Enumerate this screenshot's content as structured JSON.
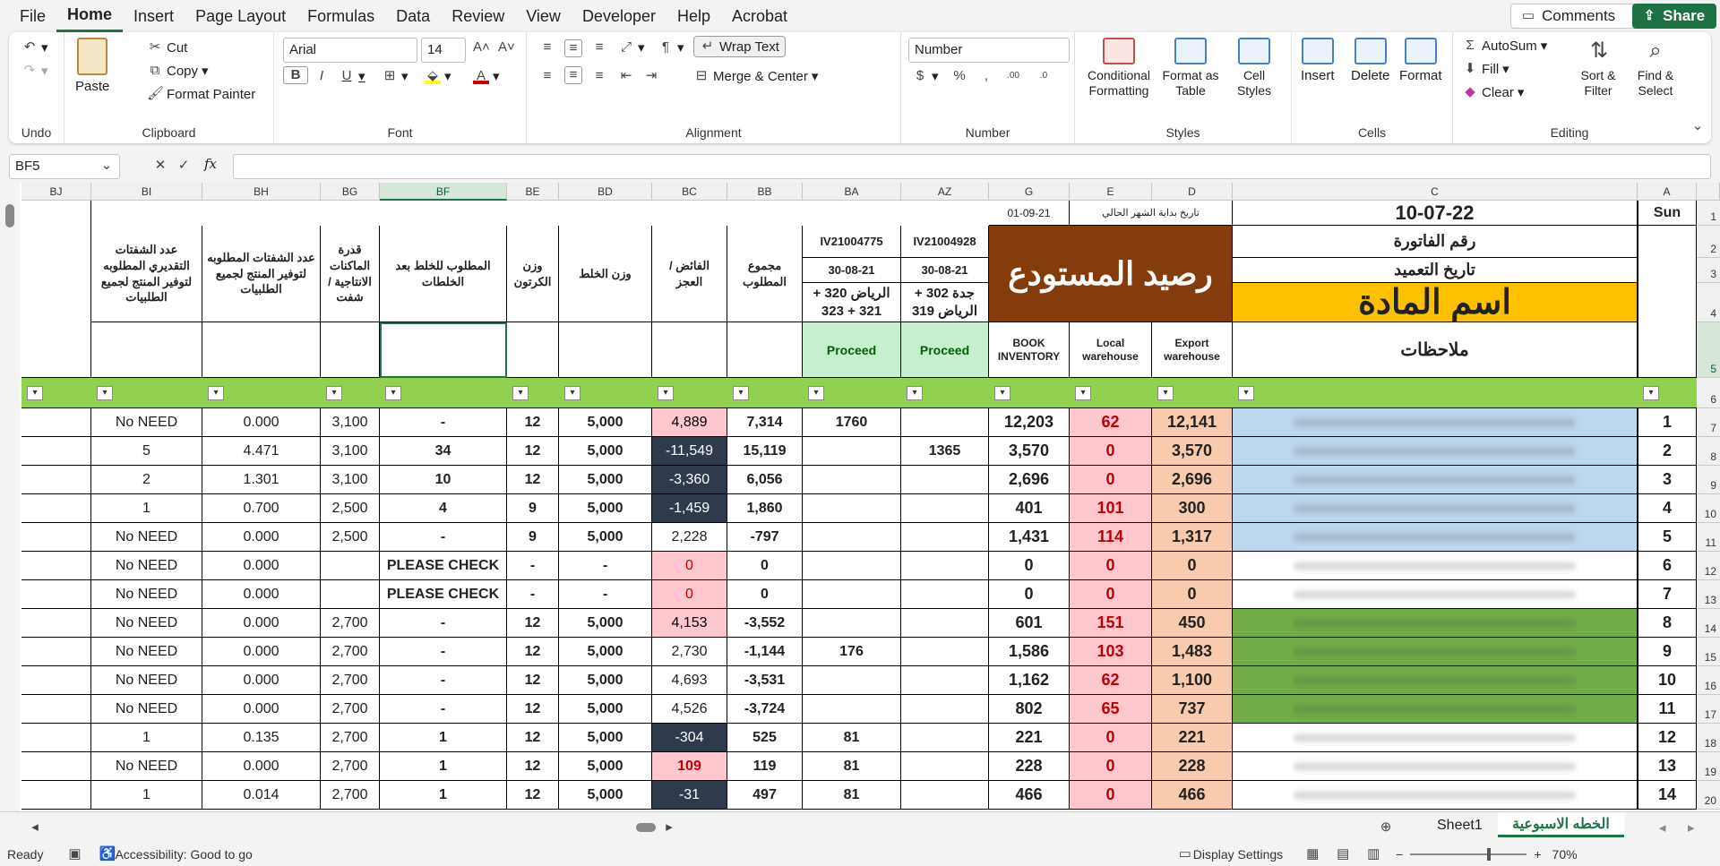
{
  "menu": {
    "items": [
      "File",
      "Home",
      "Insert",
      "Page Layout",
      "Formulas",
      "Data",
      "Review",
      "View",
      "Developer",
      "Help",
      "Acrobat"
    ],
    "active": "Home"
  },
  "top_buttons": {
    "comments": "Comments",
    "share": "Share"
  },
  "ribbon": {
    "undo_group": "Undo",
    "clipboard": {
      "paste": "Paste",
      "cut": "Cut",
      "copy": "Copy",
      "format_painter": "Format Painter",
      "label": "Clipboard"
    },
    "font": {
      "name": "Arial",
      "size": "14",
      "label": "Font"
    },
    "alignment": {
      "wrap_text": "Wrap Text",
      "merge_center": "Merge & Center",
      "label": "Alignment"
    },
    "number": {
      "format": "Number",
      "label": "Number"
    },
    "styles": {
      "conditional": "Conditional Formatting",
      "format_table": "Format as Table",
      "cell_styles": "Cell Styles",
      "label": "Styles"
    },
    "cells": {
      "insert": "Insert",
      "delete": "Delete",
      "format": "Format",
      "label": "Cells"
    },
    "editing": {
      "autosum": "AutoSum",
      "fill": "Fill",
      "clear": "Clear",
      "sort_filter": "Sort & Filter",
      "find_select": "Find & Select",
      "label": "Editing"
    }
  },
  "formula_bar": {
    "name_box": "BF5",
    "fx": "fx",
    "formula": ""
  },
  "columns": [
    "BJ",
    "BI",
    "BH",
    "BG",
    "BF",
    "BE",
    "BD",
    "BC",
    "BB",
    "BA",
    "AZ",
    "G",
    "E",
    "D",
    "C",
    "A"
  ],
  "header": {
    "date_right": "10-07-22",
    "day": "Sun",
    "start_date": "01-09-21",
    "start_label": "تاريخ بداية الشهر الحالي",
    "invoice_no": "رقم الفاتورة",
    "commission_date": "تاريخ التعميد",
    "material_name": "اسم المادة",
    "notes": "ملاحظات",
    "warehouse_balance": "رصيد المستودع",
    "book_inventory": "BOOK INVENTORY",
    "local_warehouse": "Local warehouse",
    "export_warehouse": "Export warehouse",
    "ba_invoice": "IV21004775",
    "ba_date": "30-08-21",
    "ba_dest": "الرياض 320 + 321 + 323",
    "ba_status": "Proceed",
    "az_invoice": "IV21004928",
    "az_date": "30-08-21",
    "az_dest": "جدة 302 + الرياض 319",
    "az_status": "Proceed",
    "bb": "مجموع المطلوب",
    "bc": "الفائض / العجز",
    "bd": "وزن الخلط",
    "be": "وزن الكرتون",
    "bf": "المطلوب للخلط بعد الخلطات",
    "bg": "قدرة الماكنات الانتاجية / شفت",
    "bh": "عدد الشفتات المطلوبه لتوفير المنتج لجميع الطلبيات",
    "bi": "عدد الشفتات التقديري المطلوبه لتوفير المنتج لجميع الطلبيات"
  },
  "row_numbers": [
    "1",
    "2",
    "3",
    "4",
    "5",
    "6",
    "7",
    "8",
    "9",
    "10",
    "11",
    "12",
    "13",
    "14",
    "15",
    "16",
    "17",
    "18",
    "19",
    "20"
  ],
  "rows": [
    {
      "bi": "No NEED",
      "bh": "0.000",
      "bg": "3,100",
      "bf": "-",
      "be": "12",
      "bd": "5,000",
      "bc": "4,889",
      "bb": "7,314",
      "ba": "1760",
      "az": "",
      "g": "12,203",
      "e": "62",
      "d": "12,141",
      "a": "1",
      "bc_style": "pink",
      "c_style": "blue",
      "row": "7"
    },
    {
      "bi": "5",
      "bh": "4.471",
      "bg": "3,100",
      "bf": "34",
      "be": "12",
      "bd": "5,000",
      "bc": "-11,549",
      "bb": "15,119",
      "ba": "",
      "az": "1365",
      "g": "3,570",
      "e": "0",
      "d": "3,570",
      "a": "2",
      "bc_style": "dark",
      "c_style": "blue",
      "row": "8"
    },
    {
      "bi": "2",
      "bh": "1.301",
      "bg": "3,100",
      "bf": "10",
      "be": "12",
      "bd": "5,000",
      "bc": "-3,360",
      "bb": "6,056",
      "ba": "",
      "az": "",
      "g": "2,696",
      "e": "0",
      "d": "2,696",
      "a": "3",
      "bc_style": "dark",
      "c_style": "blue",
      "row": "9"
    },
    {
      "bi": "1",
      "bh": "0.700",
      "bg": "2,500",
      "bf": "4",
      "be": "9",
      "bd": "5,000",
      "bc": "-1,459",
      "bb": "1,860",
      "ba": "",
      "az": "",
      "g": "401",
      "e": "101",
      "d": "300",
      "a": "4",
      "bc_style": "dark",
      "c_style": "blue",
      "row": "10"
    },
    {
      "bi": "No NEED",
      "bh": "0.000",
      "bg": "2,500",
      "bf": "-",
      "be": "9",
      "bd": "5,000",
      "bc": "2,228",
      "bb": "-797",
      "ba": "",
      "az": "",
      "g": "1,431",
      "e": "114",
      "d": "1,317",
      "a": "5",
      "bc_style": "none",
      "c_style": "blue",
      "row": "11"
    },
    {
      "bi": "No NEED",
      "bh": "0.000",
      "bg": "",
      "bf": "PLEASE CHECK",
      "be": "-",
      "bd": "-",
      "bc": "0",
      "bb": "0",
      "ba": "",
      "az": "",
      "g": "0",
      "e": "0",
      "d": "0",
      "a": "6",
      "bc_style": "pinkred",
      "c_style": "none",
      "row": "12"
    },
    {
      "bi": "No NEED",
      "bh": "0.000",
      "bg": "",
      "bf": "PLEASE CHECK",
      "be": "-",
      "bd": "-",
      "bc": "0",
      "bb": "0",
      "ba": "",
      "az": "",
      "g": "0",
      "e": "0",
      "d": "0",
      "a": "7",
      "bc_style": "pinkred",
      "c_style": "none",
      "row": "13"
    },
    {
      "bi": "No NEED",
      "bh": "0.000",
      "bg": "2,700",
      "bf": "-",
      "be": "12",
      "bd": "5,000",
      "bc": "4,153",
      "bb": "-3,552",
      "ba": "",
      "az": "",
      "g": "601",
      "e": "151",
      "d": "450",
      "a": "8",
      "bc_style": "pink",
      "c_style": "green",
      "row": "14"
    },
    {
      "bi": "No NEED",
      "bh": "0.000",
      "bg": "2,700",
      "bf": "-",
      "be": "12",
      "bd": "5,000",
      "bc": "2,730",
      "bb": "-1,144",
      "ba": "176",
      "az": "",
      "g": "1,586",
      "e": "103",
      "d": "1,483",
      "a": "9",
      "bc_style": "none",
      "c_style": "green",
      "row": "15"
    },
    {
      "bi": "No NEED",
      "bh": "0.000",
      "bg": "2,700",
      "bf": "-",
      "be": "12",
      "bd": "5,000",
      "bc": "4,693",
      "bb": "-3,531",
      "ba": "",
      "az": "",
      "g": "1,162",
      "e": "62",
      "d": "1,100",
      "a": "10",
      "bc_style": "none",
      "c_style": "green",
      "row": "16"
    },
    {
      "bi": "No NEED",
      "bh": "0.000",
      "bg": "2,700",
      "bf": "-",
      "be": "12",
      "bd": "5,000",
      "bc": "4,526",
      "bb": "-3,724",
      "ba": "",
      "az": "",
      "g": "802",
      "e": "65",
      "d": "737",
      "a": "11",
      "bc_style": "none",
      "c_style": "green",
      "row": "17"
    },
    {
      "bi": "1",
      "bh": "0.135",
      "bg": "2,700",
      "bf": "1",
      "be": "12",
      "bd": "5,000",
      "bc": "-304",
      "bb": "525",
      "ba": "81",
      "az": "",
      "g": "221",
      "e": "0",
      "d": "221",
      "a": "12",
      "bc_style": "dark",
      "c_style": "none",
      "row": "18"
    },
    {
      "bi": "No NEED",
      "bh": "0.000",
      "bg": "2,700",
      "bf": "1",
      "be": "12",
      "bd": "5,000",
      "bc": "109",
      "bb": "119",
      "ba": "81",
      "az": "",
      "g": "228",
      "e": "0",
      "d": "228",
      "a": "13",
      "bc_style": "red",
      "c_style": "none",
      "row": "19"
    },
    {
      "bi": "1",
      "bh": "0.014",
      "bg": "2,700",
      "bf": "1",
      "be": "12",
      "bd": "5,000",
      "bc": "-31",
      "bb": "497",
      "ba": "81",
      "az": "",
      "g": "466",
      "e": "0",
      "d": "466",
      "a": "14",
      "bc_style": "dark",
      "c_style": "none",
      "row": "20"
    }
  ],
  "tabs": {
    "sheet1": "Sheet1",
    "weekly": "الخطه الاسبوعية"
  },
  "status": {
    "ready": "Ready",
    "accessibility": "Accessibility: Good to go",
    "display_settings": "Display Settings",
    "zoom": "70%"
  },
  "colors": {
    "accent": "#217346",
    "green_bar": "#92d050",
    "brown": "#843c0c",
    "gold": "#ffc000",
    "pink": "#ffc7ce",
    "dark": "#2f3b4c",
    "peach": "#f8cbad",
    "proceed": "#c6efce"
  }
}
